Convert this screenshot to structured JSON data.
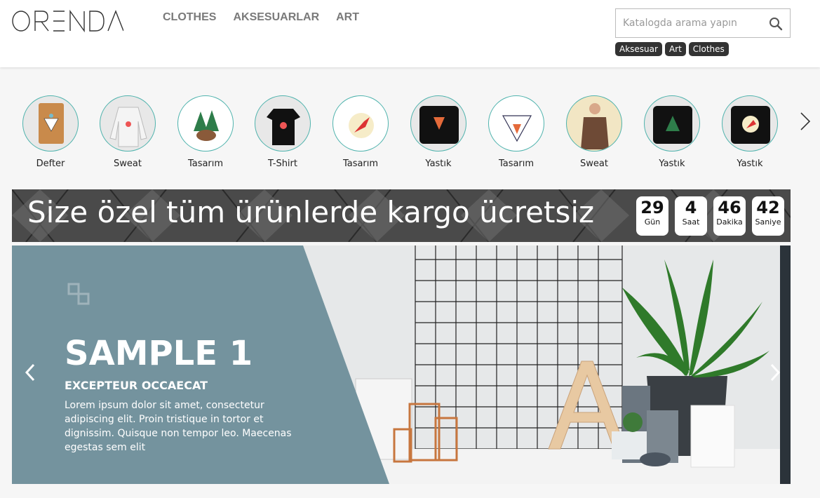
{
  "header": {
    "logo": "ORENDA",
    "nav": [
      "CLOTHES",
      "AKSESUARLAR",
      "ART"
    ],
    "search": {
      "placeholder": "Katalogda arama yapın",
      "value": ""
    },
    "tags": [
      "Aksesuar",
      "Art",
      "Clothes"
    ]
  },
  "categories": [
    {
      "label": "Defter",
      "icon": "notebook-product"
    },
    {
      "label": "Sweat",
      "icon": "white-sweatshirt-product"
    },
    {
      "label": "Tasarım",
      "icon": "bear-forest-design"
    },
    {
      "label": "T-Shirt",
      "icon": "black-tshirt-product"
    },
    {
      "label": "Tasarım",
      "icon": "hummingbird-design"
    },
    {
      "label": "Yastık",
      "icon": "black-pillow-fox"
    },
    {
      "label": "Tasarım",
      "icon": "fox-triangle-design"
    },
    {
      "label": "Sweat",
      "icon": "brown-sweatshirt-model"
    },
    {
      "label": "Yastık",
      "icon": "black-pillow-forest"
    },
    {
      "label": "Yastık",
      "icon": "black-pillow-bird"
    }
  ],
  "banner": {
    "text": "Size özel tüm ürünlerde kargo ücretsiz",
    "countdown": [
      {
        "value": "29",
        "unit": "Gün"
      },
      {
        "value": "4",
        "unit": "Saat"
      },
      {
        "value": "46",
        "unit": "Dakika"
      },
      {
        "value": "42",
        "unit": "Saniye"
      }
    ]
  },
  "slider": {
    "title": "SAMPLE 1",
    "subtitle": "EXCEPTEUR OCCAECAT",
    "description": "Lorem ipsum dolor sit amet, consectetur adipiscing elit. Proin tristique in tortor et dignissim. Quisque non tempor leo. Maecenas egestas sem elit",
    "panel_color": "#74939e"
  }
}
